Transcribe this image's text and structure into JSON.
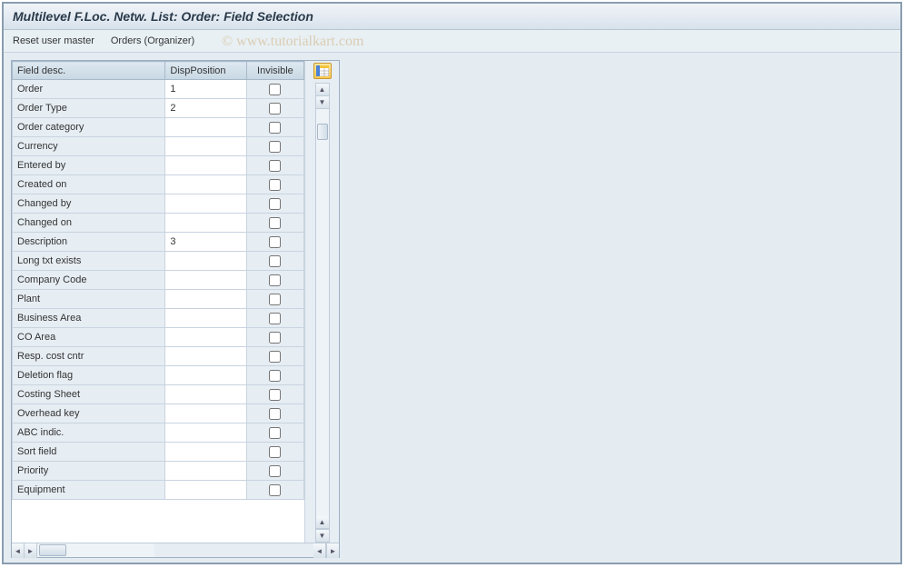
{
  "title": "Multilevel F.Loc. Netw. List: Order: Field Selection",
  "toolbar": {
    "reset_label": "Reset user master",
    "orders_label": "Orders (Organizer)"
  },
  "watermark": "© www.tutorialkart.com",
  "columns": {
    "desc": "Field desc.",
    "pos": "DispPosition",
    "inv": "Invisible"
  },
  "rows": [
    {
      "desc": "Order",
      "pos": "1",
      "inv": false
    },
    {
      "desc": "Order Type",
      "pos": "2",
      "inv": false
    },
    {
      "desc": "Order category",
      "pos": "",
      "inv": false
    },
    {
      "desc": "Currency",
      "pos": "",
      "inv": false
    },
    {
      "desc": "Entered by",
      "pos": "",
      "inv": false
    },
    {
      "desc": "Created on",
      "pos": "",
      "inv": false
    },
    {
      "desc": "Changed by",
      "pos": "",
      "inv": false
    },
    {
      "desc": "Changed on",
      "pos": "",
      "inv": false
    },
    {
      "desc": "Description",
      "pos": "3",
      "inv": false
    },
    {
      "desc": "Long txt exists",
      "pos": "",
      "inv": false
    },
    {
      "desc": "Company Code",
      "pos": "",
      "inv": false
    },
    {
      "desc": "Plant",
      "pos": "",
      "inv": false
    },
    {
      "desc": "Business Area",
      "pos": "",
      "inv": false
    },
    {
      "desc": "CO Area",
      "pos": "",
      "inv": false
    },
    {
      "desc": "Resp. cost cntr",
      "pos": "",
      "inv": false
    },
    {
      "desc": "Deletion flag",
      "pos": "",
      "inv": false
    },
    {
      "desc": "Costing Sheet",
      "pos": "",
      "inv": false
    },
    {
      "desc": "Overhead key",
      "pos": "",
      "inv": false
    },
    {
      "desc": "ABC indic.",
      "pos": "",
      "inv": false
    },
    {
      "desc": "Sort field",
      "pos": "",
      "inv": false
    },
    {
      "desc": "Priority",
      "pos": "",
      "inv": false
    },
    {
      "desc": "Equipment",
      "pos": "",
      "inv": false
    }
  ]
}
